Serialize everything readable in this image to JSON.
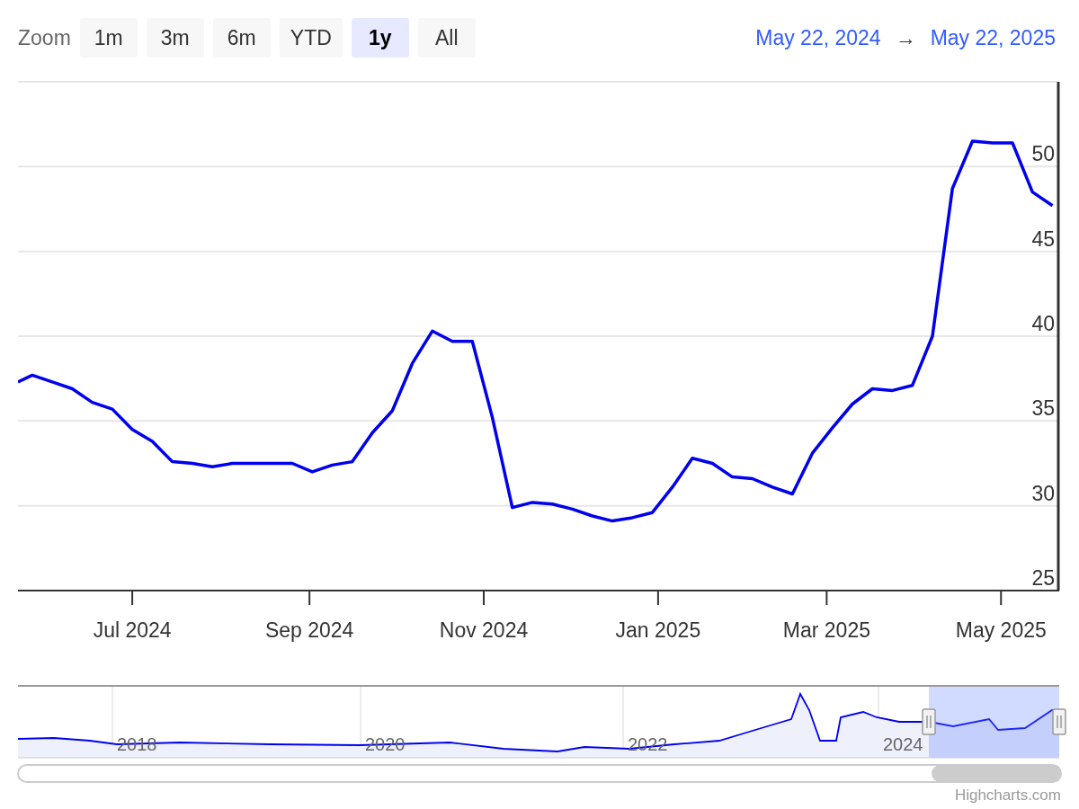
{
  "zoom": {
    "label": "Zoom",
    "buttons": [
      {
        "label": "1m",
        "selected": false
      },
      {
        "label": "3m",
        "selected": false
      },
      {
        "label": "6m",
        "selected": false
      },
      {
        "label": "YTD",
        "selected": false
      },
      {
        "label": "1y",
        "selected": true
      },
      {
        "label": "All",
        "selected": false
      }
    ]
  },
  "date_range": {
    "from": "May 22, 2024",
    "separator": "→",
    "to": "May 22, 2025"
  },
  "chart": {
    "chart_data": {
      "type": "line",
      "grid": true,
      "xlim": [
        "2024-05-22",
        "2025-05-22"
      ],
      "ylim": [
        25,
        55
      ],
      "yticks": [
        25,
        30,
        35,
        40,
        45,
        50
      ],
      "xticks": [
        {
          "value": "2024-07-01",
          "label": "Jul 2024"
        },
        {
          "value": "2024-09-01",
          "label": "Sep 2024"
        },
        {
          "value": "2024-11-01",
          "label": "Nov 2024"
        },
        {
          "value": "2025-01-01",
          "label": "Jan 2025"
        },
        {
          "value": "2025-03-01",
          "label": "Mar 2025"
        },
        {
          "value": "2025-05-01",
          "label": "May 2025"
        }
      ],
      "x": [
        "2024-05-22",
        "2024-05-27",
        "2024-06-03",
        "2024-06-10",
        "2024-06-17",
        "2024-06-24",
        "2024-07-01",
        "2024-07-08",
        "2024-07-15",
        "2024-07-22",
        "2024-07-29",
        "2024-08-05",
        "2024-08-12",
        "2024-08-19",
        "2024-08-26",
        "2024-09-02",
        "2024-09-09",
        "2024-09-16",
        "2024-09-23",
        "2024-09-30",
        "2024-10-07",
        "2024-10-14",
        "2024-10-21",
        "2024-10-28",
        "2024-11-04",
        "2024-11-11",
        "2024-11-18",
        "2024-11-25",
        "2024-12-02",
        "2024-12-09",
        "2024-12-16",
        "2024-12-23",
        "2024-12-30",
        "2025-01-06",
        "2025-01-13",
        "2025-01-20",
        "2025-01-27",
        "2025-02-03",
        "2025-02-10",
        "2025-02-17",
        "2025-02-24",
        "2025-03-03",
        "2025-03-10",
        "2025-03-17",
        "2025-03-24",
        "2025-03-31",
        "2025-04-07",
        "2025-04-14",
        "2025-04-21",
        "2025-04-28",
        "2025-05-05",
        "2025-05-12",
        "2025-05-19"
      ],
      "series": [
        {
          "color": "#0000ee",
          "values": [
            37.3,
            37.7,
            37.3,
            36.9,
            36.1,
            35.7,
            34.5,
            33.8,
            32.6,
            32.5,
            32.3,
            32.5,
            32.5,
            32.5,
            32.5,
            32.0,
            32.4,
            32.6,
            34.3,
            35.6,
            38.4,
            40.3,
            39.7,
            39.7,
            35.2,
            29.9,
            30.2,
            30.1,
            29.8,
            29.4,
            29.1,
            29.3,
            29.6,
            31.1,
            32.8,
            32.5,
            31.7,
            31.6,
            31.1,
            30.7,
            33.1,
            34.6,
            36.0,
            36.9,
            36.8,
            37.1,
            40.0,
            48.7,
            51.5,
            51.4,
            51.4,
            48.5,
            47.7
          ]
        }
      ]
    }
  },
  "navigator": {
    "labels": [
      "2018",
      "2020",
      "2022",
      "2024"
    ]
  },
  "credits": "Highcharts.com"
}
